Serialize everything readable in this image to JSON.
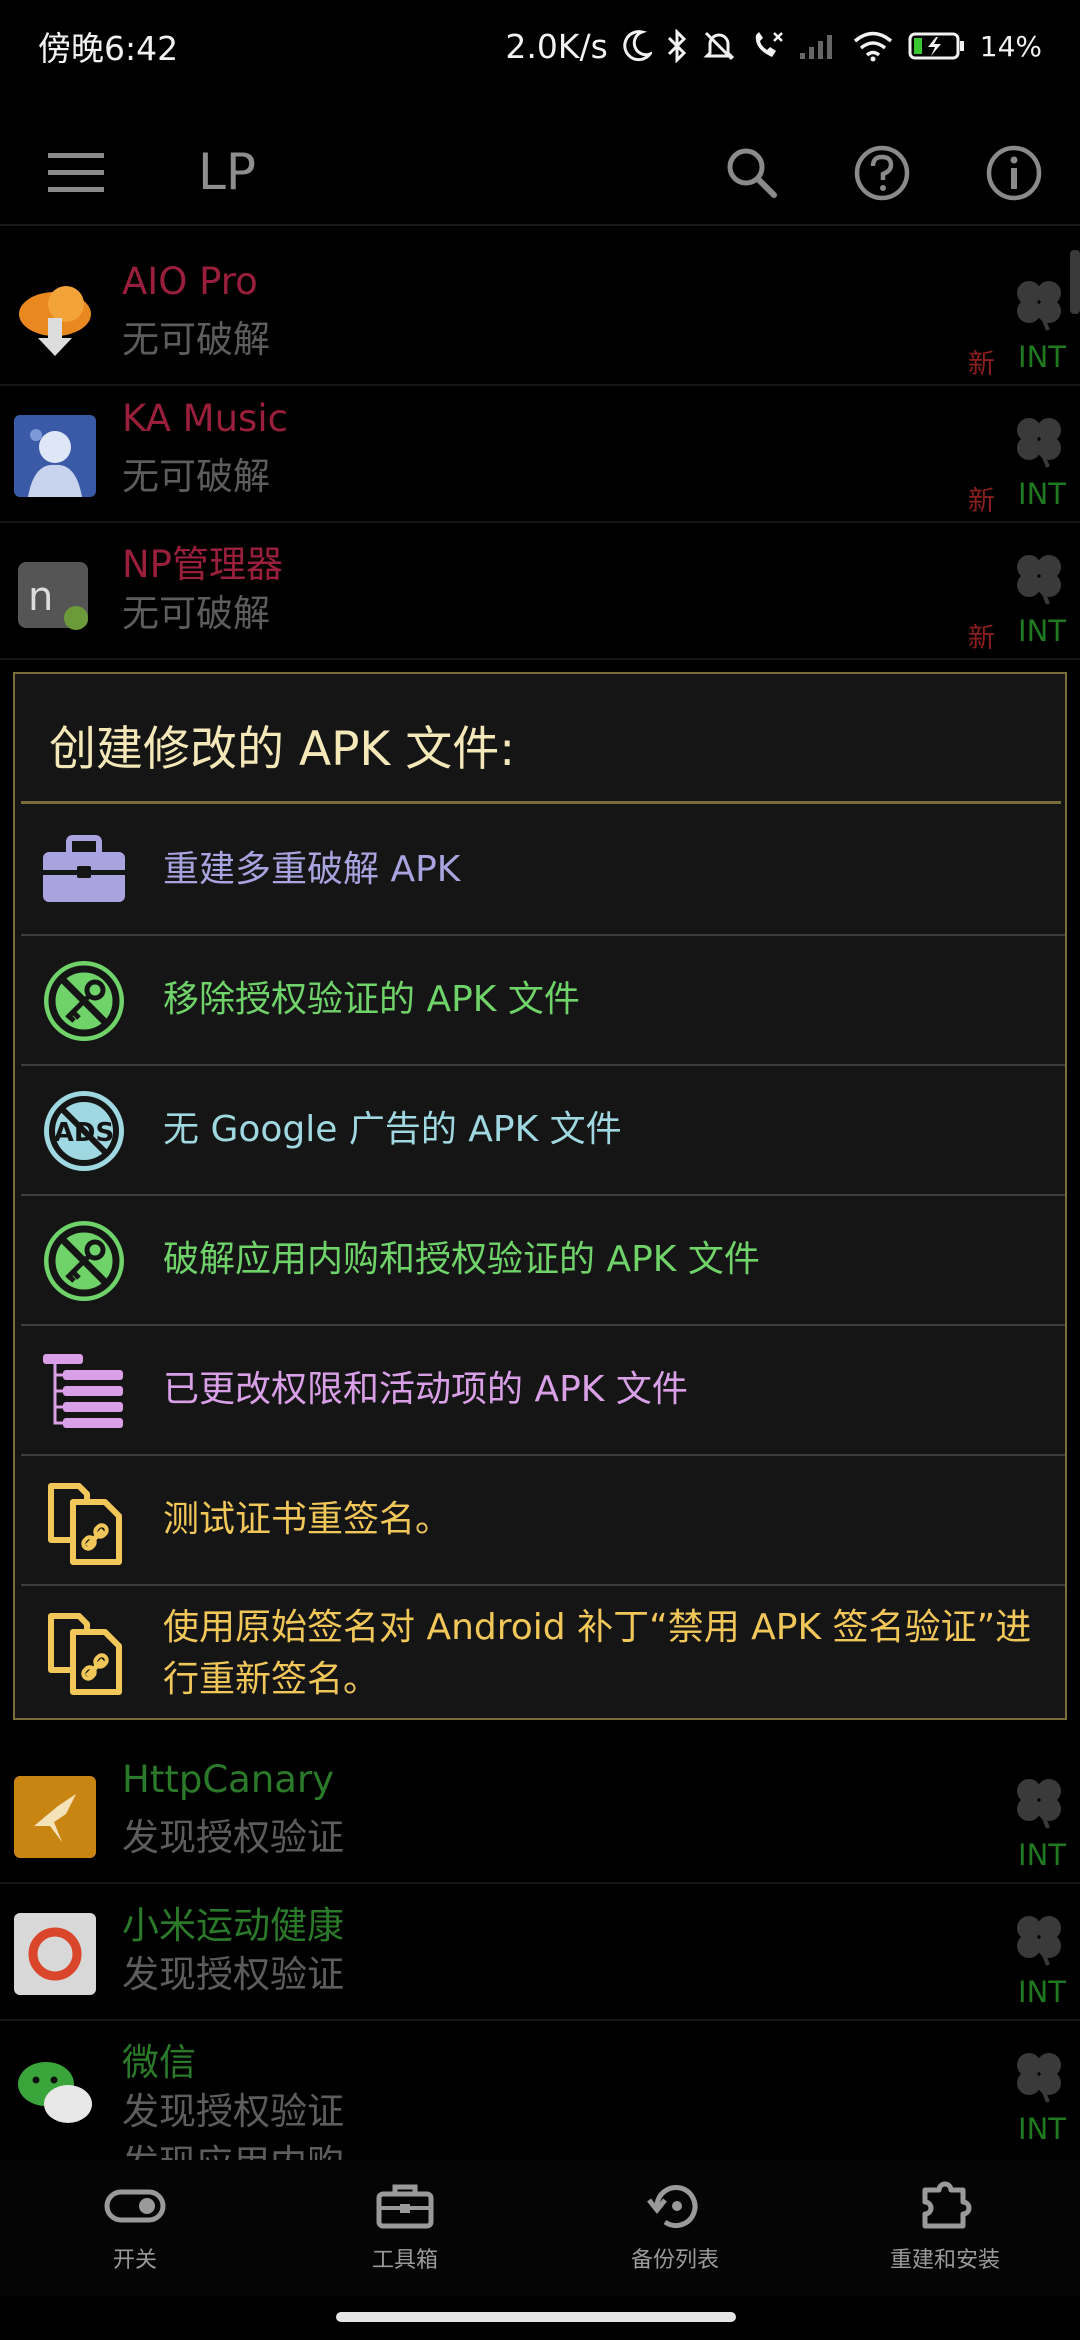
{
  "status_bar": {
    "time": "傍晚6:42",
    "speed": "2.0K/s",
    "battery": "14%"
  },
  "app_bar": {
    "title": "LP"
  },
  "apps_top": [
    {
      "name": "AIO Pro",
      "status": "无可破解",
      "tag_new": "新",
      "tag_int": "INT",
      "name_color": "#9a1f3c"
    },
    {
      "name": "KA Music",
      "status": "无可破解",
      "tag_new": "新",
      "tag_int": "INT",
      "name_color": "#9a1f3c"
    },
    {
      "name": "NP管理器",
      "status": "无可破解",
      "tag_new": "新",
      "tag_int": "INT",
      "name_color": "#9a1f3c"
    }
  ],
  "apps_bottom": [
    {
      "name": "HttpCanary",
      "status": "发现授权验证",
      "tag_int": "INT",
      "name_color": "#2a7a2a"
    },
    {
      "name": "小米运动健康",
      "status": "发现授权验证",
      "tag_int": "INT",
      "name_color": "#2a7a2a"
    },
    {
      "name": "微信",
      "status": "发现授权验证",
      "status2": "发现应用内购",
      "tag_int": "INT",
      "name_color": "#2a7a2a"
    }
  ],
  "dialog": {
    "title": "创建修改的 APK 文件:",
    "options": [
      {
        "label": "重建多重破解 APK",
        "color": "#a9a3e0",
        "icon": "toolbox-icon"
      },
      {
        "label": "移除授权验证的 APK 文件",
        "color": "#6fd36a",
        "icon": "no-key-icon"
      },
      {
        "label": "无 Google 广告的 APK 文件",
        "color": "#9fd8e0",
        "icon": "no-ads-icon"
      },
      {
        "label": "破解应用内购和授权验证的 APK 文件",
        "color": "#6fd36a",
        "icon": "no-key-icon"
      },
      {
        "label": "已更改权限和活动项的 APK 文件",
        "color": "#d9a0e8",
        "icon": "permissions-list-icon"
      },
      {
        "label": "测试证书重签名。",
        "color": "#f2c75a",
        "icon": "copy-link-icon"
      },
      {
        "label": "使用原始签名对 Android 补丁“禁用 APK 签名验证”进行重新签名。",
        "color": "#f2c75a",
        "icon": "copy-link-icon"
      }
    ]
  },
  "bottom_nav": [
    {
      "label": "开关",
      "icon": "toggle-icon"
    },
    {
      "label": "工具箱",
      "icon": "toolbox-icon"
    },
    {
      "label": "备份列表",
      "icon": "backup-icon"
    },
    {
      "label": "重建和安装",
      "icon": "puzzle-icon"
    }
  ]
}
